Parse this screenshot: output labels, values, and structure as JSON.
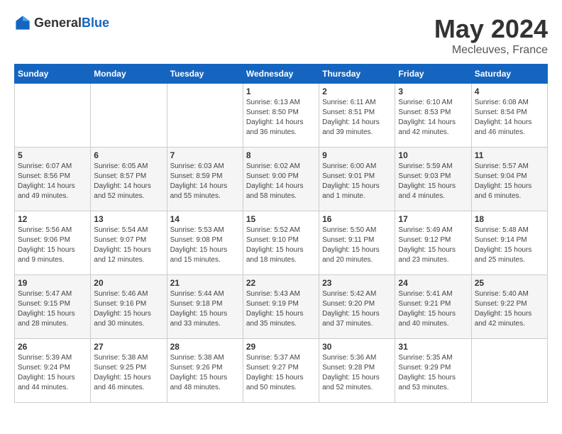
{
  "header": {
    "logo_general": "General",
    "logo_blue": "Blue",
    "month_year": "May 2024",
    "location": "Mecleuves, France"
  },
  "weekdays": [
    "Sunday",
    "Monday",
    "Tuesday",
    "Wednesday",
    "Thursday",
    "Friday",
    "Saturday"
  ],
  "weeks": [
    [
      {
        "day": "",
        "info": ""
      },
      {
        "day": "",
        "info": ""
      },
      {
        "day": "",
        "info": ""
      },
      {
        "day": "1",
        "info": "Sunrise: 6:13 AM\nSunset: 8:50 PM\nDaylight: 14 hours\nand 36 minutes."
      },
      {
        "day": "2",
        "info": "Sunrise: 6:11 AM\nSunset: 8:51 PM\nDaylight: 14 hours\nand 39 minutes."
      },
      {
        "day": "3",
        "info": "Sunrise: 6:10 AM\nSunset: 8:53 PM\nDaylight: 14 hours\nand 42 minutes."
      },
      {
        "day": "4",
        "info": "Sunrise: 6:08 AM\nSunset: 8:54 PM\nDaylight: 14 hours\nand 46 minutes."
      }
    ],
    [
      {
        "day": "5",
        "info": "Sunrise: 6:07 AM\nSunset: 8:56 PM\nDaylight: 14 hours\nand 49 minutes."
      },
      {
        "day": "6",
        "info": "Sunrise: 6:05 AM\nSunset: 8:57 PM\nDaylight: 14 hours\nand 52 minutes."
      },
      {
        "day": "7",
        "info": "Sunrise: 6:03 AM\nSunset: 8:59 PM\nDaylight: 14 hours\nand 55 minutes."
      },
      {
        "day": "8",
        "info": "Sunrise: 6:02 AM\nSunset: 9:00 PM\nDaylight: 14 hours\nand 58 minutes."
      },
      {
        "day": "9",
        "info": "Sunrise: 6:00 AM\nSunset: 9:01 PM\nDaylight: 15 hours\nand 1 minute."
      },
      {
        "day": "10",
        "info": "Sunrise: 5:59 AM\nSunset: 9:03 PM\nDaylight: 15 hours\nand 4 minutes."
      },
      {
        "day": "11",
        "info": "Sunrise: 5:57 AM\nSunset: 9:04 PM\nDaylight: 15 hours\nand 6 minutes."
      }
    ],
    [
      {
        "day": "12",
        "info": "Sunrise: 5:56 AM\nSunset: 9:06 PM\nDaylight: 15 hours\nand 9 minutes."
      },
      {
        "day": "13",
        "info": "Sunrise: 5:54 AM\nSunset: 9:07 PM\nDaylight: 15 hours\nand 12 minutes."
      },
      {
        "day": "14",
        "info": "Sunrise: 5:53 AM\nSunset: 9:08 PM\nDaylight: 15 hours\nand 15 minutes."
      },
      {
        "day": "15",
        "info": "Sunrise: 5:52 AM\nSunset: 9:10 PM\nDaylight: 15 hours\nand 18 minutes."
      },
      {
        "day": "16",
        "info": "Sunrise: 5:50 AM\nSunset: 9:11 PM\nDaylight: 15 hours\nand 20 minutes."
      },
      {
        "day": "17",
        "info": "Sunrise: 5:49 AM\nSunset: 9:12 PM\nDaylight: 15 hours\nand 23 minutes."
      },
      {
        "day": "18",
        "info": "Sunrise: 5:48 AM\nSunset: 9:14 PM\nDaylight: 15 hours\nand 25 minutes."
      }
    ],
    [
      {
        "day": "19",
        "info": "Sunrise: 5:47 AM\nSunset: 9:15 PM\nDaylight: 15 hours\nand 28 minutes."
      },
      {
        "day": "20",
        "info": "Sunrise: 5:46 AM\nSunset: 9:16 PM\nDaylight: 15 hours\nand 30 minutes."
      },
      {
        "day": "21",
        "info": "Sunrise: 5:44 AM\nSunset: 9:18 PM\nDaylight: 15 hours\nand 33 minutes."
      },
      {
        "day": "22",
        "info": "Sunrise: 5:43 AM\nSunset: 9:19 PM\nDaylight: 15 hours\nand 35 minutes."
      },
      {
        "day": "23",
        "info": "Sunrise: 5:42 AM\nSunset: 9:20 PM\nDaylight: 15 hours\nand 37 minutes."
      },
      {
        "day": "24",
        "info": "Sunrise: 5:41 AM\nSunset: 9:21 PM\nDaylight: 15 hours\nand 40 minutes."
      },
      {
        "day": "25",
        "info": "Sunrise: 5:40 AM\nSunset: 9:22 PM\nDaylight: 15 hours\nand 42 minutes."
      }
    ],
    [
      {
        "day": "26",
        "info": "Sunrise: 5:39 AM\nSunset: 9:24 PM\nDaylight: 15 hours\nand 44 minutes."
      },
      {
        "day": "27",
        "info": "Sunrise: 5:38 AM\nSunset: 9:25 PM\nDaylight: 15 hours\nand 46 minutes."
      },
      {
        "day": "28",
        "info": "Sunrise: 5:38 AM\nSunset: 9:26 PM\nDaylight: 15 hours\nand 48 minutes."
      },
      {
        "day": "29",
        "info": "Sunrise: 5:37 AM\nSunset: 9:27 PM\nDaylight: 15 hours\nand 50 minutes."
      },
      {
        "day": "30",
        "info": "Sunrise: 5:36 AM\nSunset: 9:28 PM\nDaylight: 15 hours\nand 52 minutes."
      },
      {
        "day": "31",
        "info": "Sunrise: 5:35 AM\nSunset: 9:29 PM\nDaylight: 15 hours\nand 53 minutes."
      },
      {
        "day": "",
        "info": ""
      }
    ]
  ]
}
